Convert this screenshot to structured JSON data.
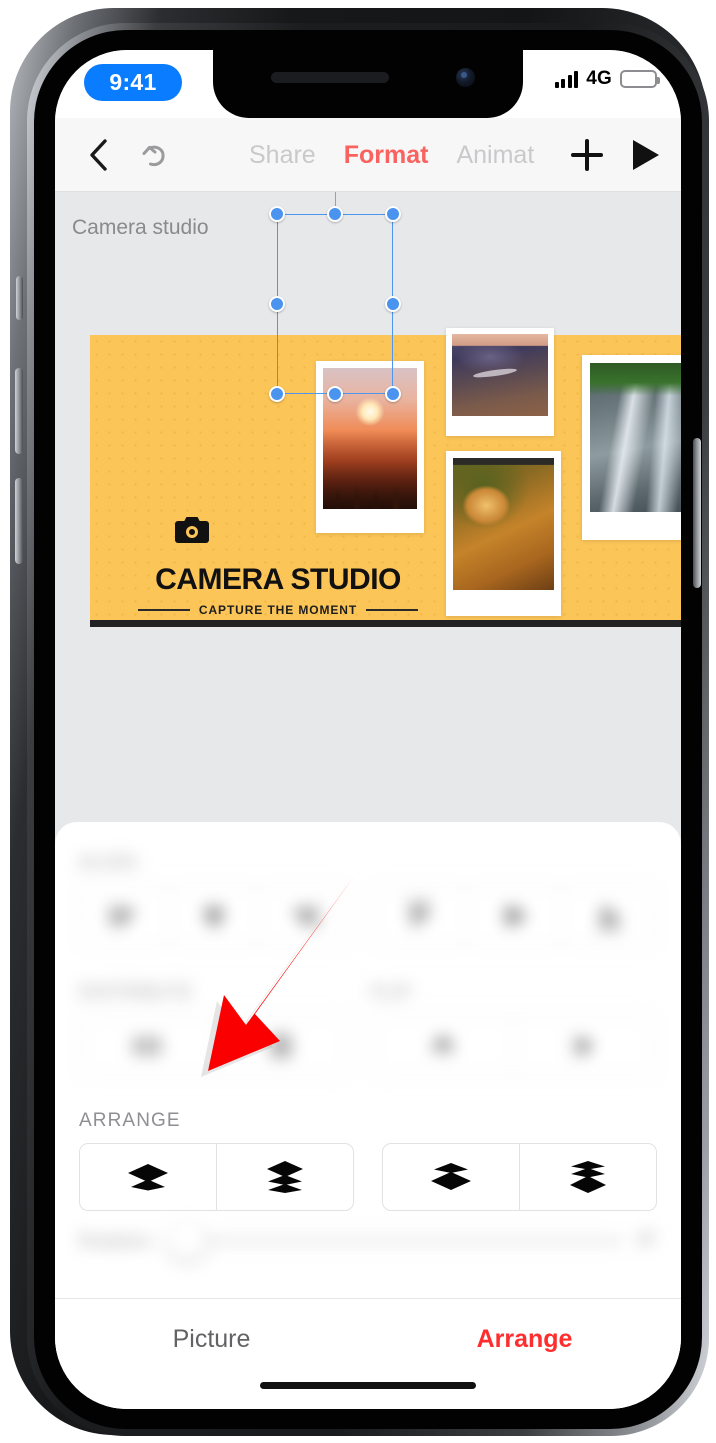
{
  "status_bar": {
    "time": "9:41",
    "network": "4G",
    "signal_icon": "signal-bars-icon",
    "battery_icon": "battery-icon",
    "battery_color": "#30d158",
    "time_pill_color": "#0a7cff"
  },
  "toolbar": {
    "back_icon": "chevron-left-icon",
    "undo_icon": "undo-arrow-icon",
    "add_icon": "plus-icon",
    "play_icon": "play-icon",
    "tabs": [
      {
        "label": "Share",
        "active": false
      },
      {
        "label": "Format",
        "active": true
      },
      {
        "label": "Animat",
        "active": false
      }
    ],
    "active_color": "#f9625f"
  },
  "canvas": {
    "document_title": "Camera studio",
    "background": "#e7e8ea",
    "slide": {
      "background": "#fbc557",
      "camera_icon": "camera-icon",
      "brand_title": "CAMERA STUDIO",
      "tagline": "CAPTURE THE MOMENT",
      "photos": [
        {
          "name": "sunset-photo",
          "selected": true
        },
        {
          "name": "mountain-photo",
          "selected": false
        },
        {
          "name": "spider-photo",
          "selected": false
        },
        {
          "name": "waterfall-photo",
          "selected": false
        }
      ]
    },
    "selection": {
      "handle_color": "#4a93ef",
      "rotation_handle_color": "#5ed45c",
      "handles": 8
    }
  },
  "panel": {
    "sections": [
      {
        "name": "align",
        "label": "ALIGN",
        "blurred": true,
        "buttons": [
          "align-left-icon",
          "align-center-icon",
          "align-right-icon"
        ]
      },
      {
        "name": "align-vertical",
        "label": "",
        "blurred": true,
        "buttons": [
          "align-top-icon",
          "align-middle-icon",
          "align-bottom-icon"
        ]
      },
      {
        "name": "distribute",
        "label": "DISTRIBUTE",
        "blurred": true,
        "buttons": [
          "distribute-horizontal-icon",
          "distribute-vertical-icon"
        ]
      },
      {
        "name": "flip",
        "label": "FLIP",
        "blurred": true,
        "buttons": [
          "flip-vertical-icon",
          "flip-horizontal-icon"
        ]
      },
      {
        "name": "arrange",
        "label": "ARRANGE",
        "blurred": false,
        "buttons": [
          "send-backward-icon",
          "send-to-back-icon",
          "bring-forward-icon",
          "bring-to-front-icon"
        ]
      }
    ],
    "rotation": {
      "label": "Rotation",
      "value": "0°",
      "blurred": true
    }
  },
  "tab_bar": {
    "tabs": [
      {
        "label": "Picture",
        "active": false
      },
      {
        "label": "Arrange",
        "active": true
      }
    ],
    "active_color": "#ff2d2d"
  },
  "annotation": {
    "arrow_color": "#fa0000",
    "points_to": "arrange-section"
  }
}
